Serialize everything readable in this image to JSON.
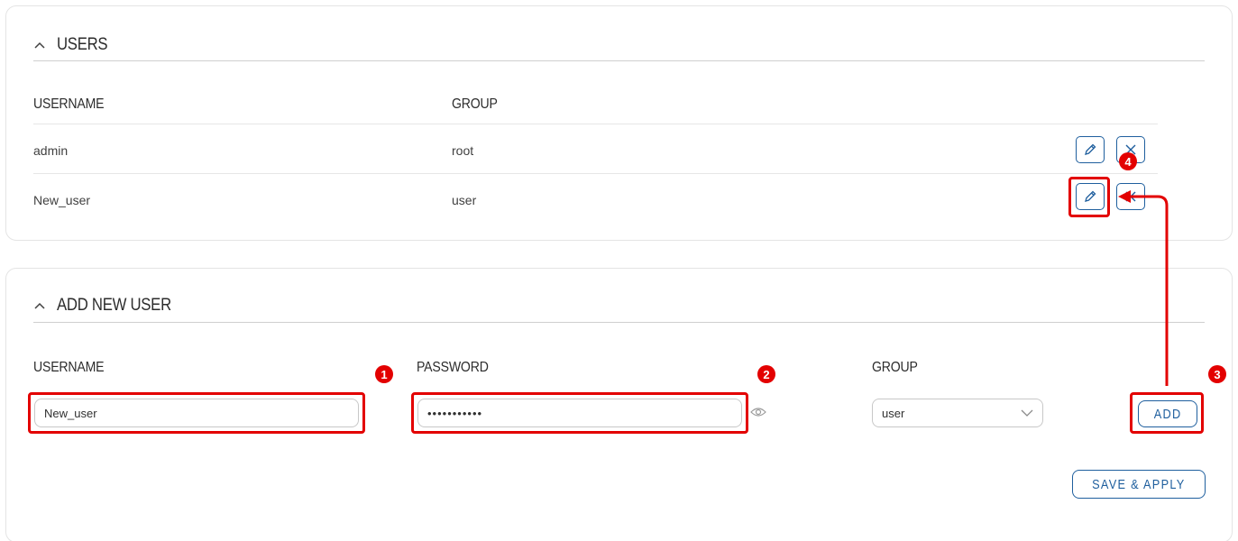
{
  "users_section": {
    "title": "USERS",
    "columns": [
      "USERNAME",
      "GROUP"
    ],
    "rows": [
      {
        "username": "admin",
        "group": "root"
      },
      {
        "username": "New_user",
        "group": "user"
      }
    ]
  },
  "add_section": {
    "title": "ADD NEW USER",
    "username_label": "USERNAME",
    "username_value": "New_user",
    "password_label": "PASSWORD",
    "password_value": "•••••••••••",
    "group_label": "GROUP",
    "group_value": "user",
    "add_label": "ADD",
    "save_label": "SAVE & APPLY"
  },
  "annotations": [
    "1",
    "2",
    "3",
    "4"
  ],
  "colors": {
    "accent": "#1f5f9e",
    "annotation": "#e30000",
    "divider": "#cfcfcf"
  }
}
